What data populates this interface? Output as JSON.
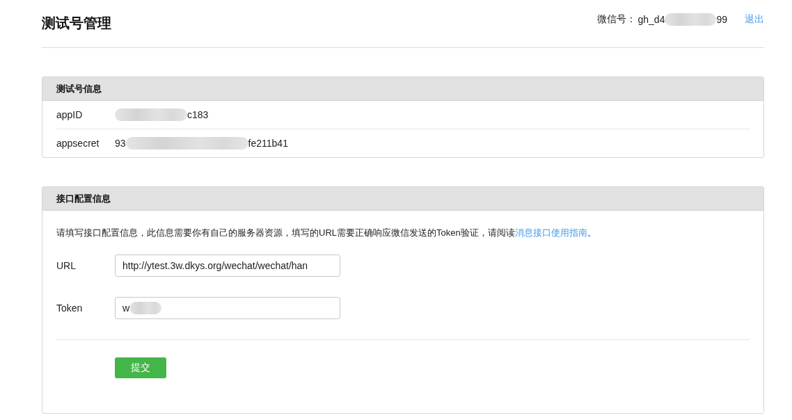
{
  "header": {
    "title": "测试号管理",
    "account_label": "微信号：",
    "account_value": [
      {
        "kind": "text",
        "text": "gh_d4"
      },
      {
        "kind": "blur"
      },
      {
        "kind": "text",
        "text": "99"
      }
    ],
    "logout_link": "退出"
  },
  "info_panel": {
    "title": "测试号信息",
    "rows": [
      {
        "label": "appID",
        "value": [
          {
            "kind": "longblur"
          },
          {
            "kind": "text",
            "text": "c183"
          }
        ]
      },
      {
        "label": "appsecret",
        "value": [
          {
            "kind": "text",
            "text": "93"
          },
          {
            "kind": "widestblur"
          },
          {
            "kind": "text",
            "text": "fe211b41"
          }
        ]
      }
    ]
  },
  "config_panel": {
    "title": "接口配置信息",
    "description": {
      "text": "请填写接口配置信息，此信息需要你有自己的服务器资源，填写的URL需要正确响应微信发送的Token验证，请阅读",
      "link": "消息接口使用指南",
      "text_after": "。"
    },
    "fields": [
      {
        "label": "URL",
        "value": [
          {
            "kind": "text",
            "text": "http://ytest.3w.dkys.org/wechat/wechat/han"
          }
        ]
      },
      {
        "label": "Token",
        "value": [
          {
            "kind": "text",
            "text": "w"
          },
          {
            "kind": "shortblur"
          }
        ]
      }
    ],
    "submit_button": "提交"
  }
}
